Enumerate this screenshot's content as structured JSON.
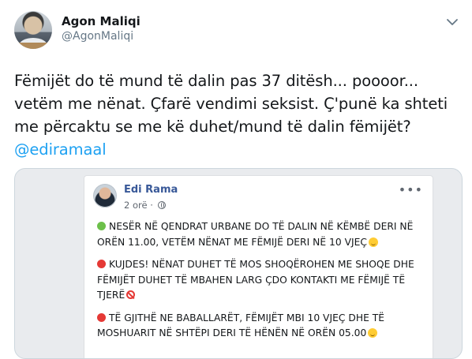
{
  "tweet": {
    "author": {
      "name": "Agon Maliqi",
      "handle": "@AgonMaliqi"
    },
    "text": "Fëmijët do të mund të dalin pas 37 ditësh... poooor...\nvetëm me nënat. Çfarë vendimi seksist. Ç'punë ka shteti\nme përcaktu se me kë duhet/mund të dalin fëmijët?\n",
    "mention": "@ediramaal",
    "icons": {
      "more": "chevron-down-icon"
    }
  },
  "embedded_post": {
    "author": "Edi Rama",
    "time": "2 orë ·",
    "icons": {
      "privacy": "globe-icon",
      "menu": "more-dots-icon"
    },
    "paragraphs": [
      {
        "marker": "green-circle-icon",
        "text": "NESËR NË QENDRAT URBANE DO TË DALIN NË KËMBË DERI NË ORËN 11.00, VETËM NËNAT ME FËMIJË DERI NË 10 VJEÇ",
        "trail": "smile-emoji-icon"
      },
      {
        "marker": "red-circle-icon",
        "text": "KUJDES! NËNAT DUHET TË MOS SHOQËROHEN ME SHOQE DHE FËMIJËT DUHET TË MBAHEN LARG ÇDO KONTAKTI ME FËMIJË TË TJERË",
        "trail": "prohibited-icon"
      },
      {
        "marker": "red-circle-icon",
        "text": "TË GJITHË NE BABALLARËT, FËMIJËT MBI 10 VJEÇ DHE TË MOSHUARIT NË SHTËPI DERI TË HËNËN NË ORËN 05.00",
        "trail": "sweat-smile-emoji-icon"
      }
    ]
  },
  "colors": {
    "link": "#1da1f2",
    "fb_name": "#385898",
    "muted": "#657786"
  }
}
